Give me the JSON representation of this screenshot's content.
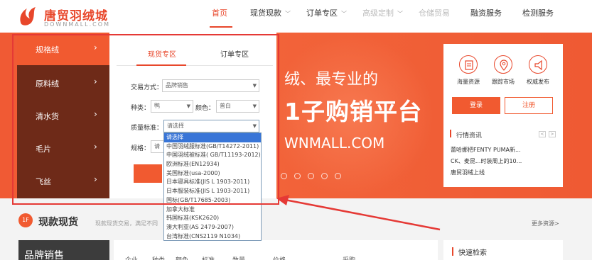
{
  "header": {
    "logo_title": "唐贸羽绒城",
    "logo_subtitle": "DOWNMALL.COM",
    "nav": [
      {
        "label": "首页",
        "state": "active"
      },
      {
        "label": "现货现款",
        "state": "normal",
        "dropdown": true
      },
      {
        "label": "订单专区",
        "state": "normal",
        "dropdown": true
      },
      {
        "label": "高级定制",
        "state": "disabled",
        "dropdown": true
      },
      {
        "label": "仓储贸易",
        "state": "disabled"
      },
      {
        "label": "融资服务",
        "state": "normal"
      },
      {
        "label": "检测服务",
        "state": "normal"
      }
    ]
  },
  "categories": [
    {
      "label": "规格绒",
      "active": true
    },
    {
      "label": "原料绒",
      "active": false
    },
    {
      "label": "清水货",
      "active": false
    },
    {
      "label": "毛片",
      "active": false
    },
    {
      "label": "飞丝",
      "active": false
    }
  ],
  "filter": {
    "tabs": [
      {
        "label": "现货专区",
        "active": true
      },
      {
        "label": "订单专区",
        "active": false
      }
    ],
    "trade_label": "交易方式：",
    "trade_value": "品牌销售",
    "kind_label": "种类：",
    "kind_value": "鸭",
    "color_label": "颜色：",
    "color_value": "普白",
    "standard_label": "质量标准：",
    "standard_value": "请选择",
    "spec_label": "规格：",
    "spec_value": "请"
  },
  "standard_options": [
    "请选择",
    "中国羽绒服标准(GB/T14272-2011)",
    "中国羽绒被标准( GB/T11193-2012)",
    "欧洲标准(EN12934)",
    "美国标准(usa-2000)",
    "日本寝具标准(JIS L 1903-2011)",
    "日本服装标准(JIS L 1903-2011)",
    "国标(GB/T17685-2003)",
    "加拿大标准",
    "韩国标准(KSK2620)",
    "澳大利亚(AS 2479-2007)",
    "台湾标准(CNS2119 N1034)"
  ],
  "banner": {
    "line1": "绒、最专业的",
    "line2": "1子购销平台",
    "line3": "WNMALL.COM"
  },
  "card": {
    "features": [
      "海量资源",
      "跟踪市场",
      "权威发布"
    ],
    "login": "登录",
    "register": "注册",
    "news_title": "行情资讯",
    "news_prev": "<",
    "news_next": ">",
    "news_items": [
      "蕾哈娜把FENTY PUMA新...",
      "CK、麦昆...时装周上的10...",
      "唐贸羽绒上线"
    ]
  },
  "section": {
    "badge": "1F",
    "title": "现款现货",
    "desc": "现款现货交易，满足不同",
    "more": "更多资源>",
    "brand": "品牌销售",
    "columns": [
      "企业",
      "种类",
      "颜色",
      "标准",
      "数量",
      "",
      "价格",
      "采购"
    ],
    "quick_search": "快速检索"
  }
}
